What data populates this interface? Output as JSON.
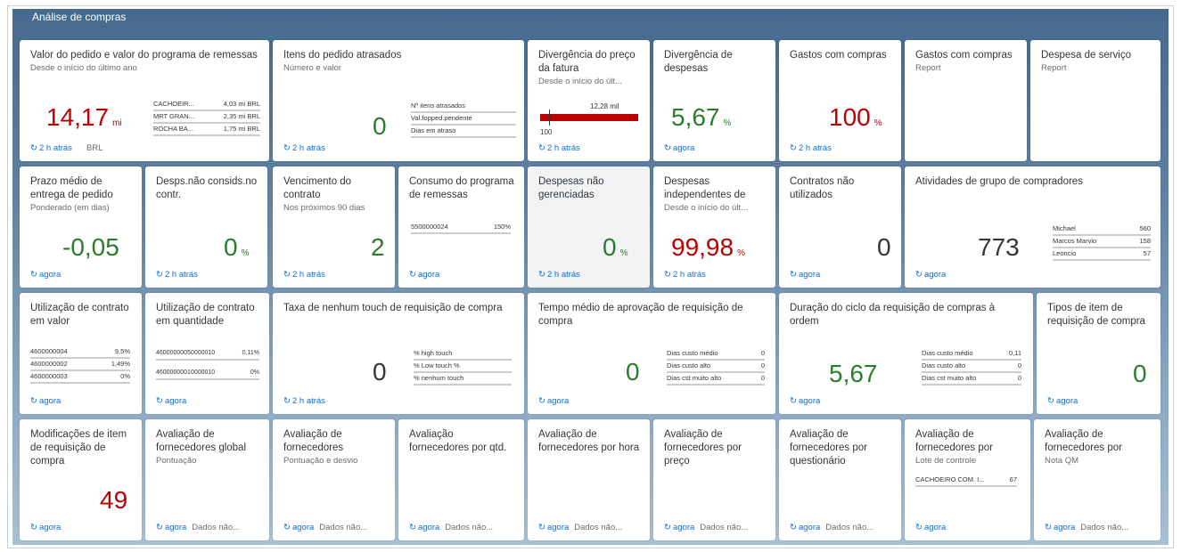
{
  "page_title": "Análise de compras",
  "colors": {
    "positive": "#2b7d2b",
    "negative": "#bb0000",
    "link": "#0a6ed1"
  },
  "icons": {
    "refresh": "refresh-icon"
  },
  "row1": {
    "t1": {
      "title": "Valor do pedido e valor do programa de remessas",
      "sub": "Desde o início do último ano",
      "value": "14,17",
      "unit": "mi",
      "footer": "2 h atrás",
      "note": "BRL",
      "rows": [
        {
          "l": "CACHOEIR... ",
          "v": "4,03 mi BRL"
        },
        {
          "l": "MRT GRAN...",
          "v": "2,35 mi BRL"
        },
        {
          "l": "ROCHA BA...",
          "v": "1,75 mi BRL"
        }
      ]
    },
    "t2": {
      "title": "Itens do pedido atrasados",
      "sub": "Número e valor",
      "value": "0",
      "footer": "2 h atrás",
      "rows": [
        {
          "l": "Nº itens atrasados",
          "v": ""
        },
        {
          "l": "Val.fopped.pendente",
          "v": ""
        },
        {
          "l": "Dias em atraso",
          "v": ""
        }
      ]
    },
    "t3": {
      "title": "Divergência do preço da fatura",
      "sub": "Desde o início do últ...",
      "bar_label": "12,28 mil",
      "base_label": "100",
      "footer": "2 h atrás"
    },
    "t4": {
      "title": "Divergência de despesas",
      "value": "5,67",
      "unit": "%",
      "footer": "agora"
    },
    "t5": {
      "title": "Gastos com compras",
      "value": "100",
      "unit": "%",
      "footer": "2 h atrás"
    },
    "t6": {
      "title": "Gastos com compras",
      "sub": "Report"
    },
    "t7": {
      "title": "Despesa de serviço",
      "sub": "Report"
    }
  },
  "row2": {
    "t1": {
      "title": "Prazo médio de entrega de pedido",
      "sub": "Ponderado (em dias)",
      "value": "-0,05",
      "footer": "agora"
    },
    "t2": {
      "title": "Desps.não consids.no contr.",
      "value": "0",
      "unit": "%",
      "footer": "2 h atrás"
    },
    "t3": {
      "title": "Vencimento do contrato",
      "sub": "Nos próximos 90 dias",
      "value": "2",
      "footer": "2 h atrás"
    },
    "t4": {
      "title": "Consumo do programa de remessas",
      "rows": [
        {
          "l": "5500000024",
          "v": "150%"
        }
      ],
      "footer": "agora"
    },
    "t5": {
      "title": "Despesas não gerenciadas",
      "value": "0",
      "unit": "%",
      "footer": "2 h atrás"
    },
    "t6": {
      "title": "Despesas independentes de",
      "sub": "Desde o início do últ...",
      "value": "99,98",
      "unit": "%",
      "footer": "2 h atrás"
    },
    "t7": {
      "title": "Contratos não utilizados",
      "value": "0",
      "footer": "agora"
    },
    "t8": {
      "title": "Atividades de grupo de compradores",
      "value": "773",
      "footer": "agora",
      "rows": [
        {
          "l": "Michael",
          "v": "560"
        },
        {
          "l": "Marcos Marvio",
          "v": "158"
        },
        {
          "l": "Leoncio",
          "v": "57"
        }
      ]
    }
  },
  "row3": {
    "t1": {
      "title": "Utilização de contrato em valor",
      "footer": "agora",
      "rows": [
        {
          "l": "4600000004",
          "v": "9,5%"
        },
        {
          "l": "4600000002",
          "v": "1,49%"
        },
        {
          "l": "4600000003",
          "v": "0%"
        }
      ]
    },
    "t2": {
      "title": "Utilização de contrato em quantidade",
      "footer": "agora",
      "rows": [
        {
          "l": "46000000050000010",
          "v": "0,11%"
        },
        {
          "l": "46000000010000010",
          "v": "0%"
        }
      ]
    },
    "t3": {
      "title": "Taxa de nenhum touch de requisição de compra",
      "value": "0",
      "footer": "2 h atrás",
      "rows": [
        {
          "l": "% high touch",
          "v": ""
        },
        {
          "l": "% Low touch %",
          "v": ""
        },
        {
          "l": "% nenhum touch",
          "v": ""
        }
      ]
    },
    "t4": {
      "title": "Tempo médio de aprovação de requisição de compra",
      "value": "0",
      "footer": "agora",
      "rows": [
        {
          "l": "Dias custo médio",
          "v": "0"
        },
        {
          "l": "Dias custo alto",
          "v": "0"
        },
        {
          "l": "Dias cst muito alto",
          "v": "0"
        }
      ]
    },
    "t5": {
      "title": "Duração do ciclo da requisição de compras à ordem",
      "value": "5,67",
      "footer": "agora",
      "rows": [
        {
          "l": "Dias custo médio",
          "v": "0,11"
        },
        {
          "l": "Dias custo alto",
          "v": "0"
        },
        {
          "l": "Dias cst muito alto",
          "v": "0"
        }
      ]
    },
    "t6": {
      "title": "Tipos de item de requisição de compra",
      "value": "0",
      "footer": "agora"
    }
  },
  "row4": {
    "t1": {
      "title": "Modificações de item de requisição de compra",
      "value": "49",
      "footer": "agora"
    },
    "t2": {
      "title": "Avaliação de fornecedores global",
      "sub": "Pontuação",
      "footer": "agora",
      "note": "Dados não..."
    },
    "t3": {
      "title": "Avaliação de fornecedores",
      "sub": "Pontuação e desvio",
      "footer": "agora",
      "note": "Dados não..."
    },
    "t4": {
      "title": "Avaliação fornecedores por qtd.",
      "footer": "agora",
      "note": "Dados não..."
    },
    "t5": {
      "title": "Avaliação de fornecedores por hora",
      "footer": "agora",
      "note": "Dados não..."
    },
    "t6": {
      "title": "Avaliação de fornecedores por preço",
      "footer": "agora",
      "note": "Dados não..."
    },
    "t7": {
      "title": "Avaliação de fornecedores por questionário",
      "footer": "agora",
      "note": "Dados não..."
    },
    "t8": {
      "title": "Avaliação de fornecedores por",
      "sub": "Lote de controle",
      "footer": "agora",
      "rows": [
        {
          "l": "CACHOEIRO COM. I...",
          "v": "67"
        }
      ]
    },
    "t9": {
      "title": "Avaliação de fornecedores por",
      "sub": "Nota QM",
      "footer": "agora",
      "note": "Dados não..."
    }
  }
}
